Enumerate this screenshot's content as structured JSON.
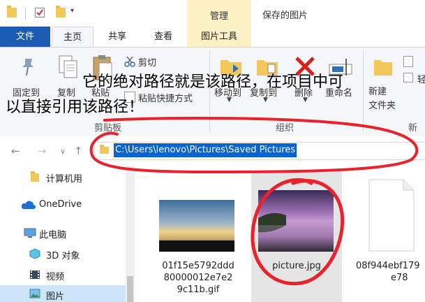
{
  "titlebar": {
    "manage_tab": "管理",
    "window_title": "保存的图片"
  },
  "tabs": [
    {
      "label": "文件"
    },
    {
      "label": "主页"
    },
    {
      "label": "共享"
    },
    {
      "label": "查看"
    },
    {
      "label": "图片工具"
    }
  ],
  "ribbon": {
    "pin_label": "固定到",
    "copy_label": "复制",
    "paste_label": "粘贴",
    "cut_label": "剪切",
    "paste_shortcut_label": "粘贴快捷方式",
    "clipboard_group": "剪贴板",
    "move_to_label": "移动到",
    "copy_to_label": "复制到",
    "delete_label": "删除",
    "rename_label": "重命名",
    "organize_group": "组织",
    "new_folder_label": "新建\n文件夹",
    "new_group": "新建",
    "lightly_partial": "轻"
  },
  "address": {
    "path": "C:\\Users\\lenovo\\Pictures\\Saved Pictures"
  },
  "sidebar": {
    "items": [
      {
        "label": "计算机用",
        "icon": "folder-icon"
      },
      {
        "label": "OneDrive",
        "icon": "cloud-icon"
      },
      {
        "label": "此电脑",
        "icon": "computer-icon"
      },
      {
        "label": "3D 对象",
        "icon": "cube-icon"
      },
      {
        "label": "视频",
        "icon": "video-icon"
      },
      {
        "label": "图片",
        "icon": "pictures-icon"
      }
    ]
  },
  "files": [
    {
      "name_lines": [
        "01f15e5792ddd",
        "80000012e7e2",
        "9c11b.gif"
      ],
      "type": "image"
    },
    {
      "name_lines": [
        "picture.jpg"
      ],
      "type": "image",
      "selected": true
    },
    {
      "name_lines": [
        "08f944ebf179",
        "e78"
      ],
      "type": "document"
    }
  ],
  "annotation": {
    "line1": "它的绝对路径就是该路径，在项目中可",
    "line2": "以直接引用该路径！",
    "color": "#e8232d"
  }
}
